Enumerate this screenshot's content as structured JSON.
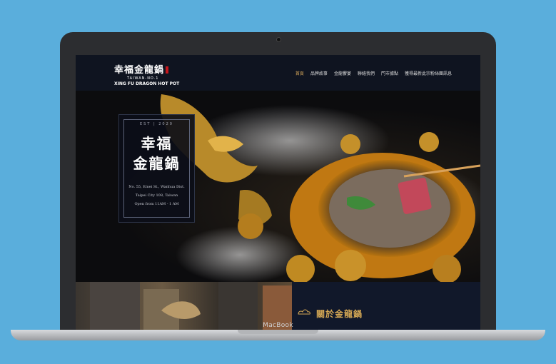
{
  "device": {
    "label": "MacBook"
  },
  "site": {
    "logo": {
      "cn": "幸福金龍鍋",
      "sub": "TAIWAN-NO.1",
      "en": "XING FU DRAGON HOT POT"
    },
    "nav": [
      "首頁",
      "品牌故事",
      "金龍饗宴",
      "聯絡我們",
      "門市據點",
      "獲得最新此宗粉絲團訊息"
    ],
    "hero_card": {
      "est": "EST | 2020",
      "title_line1": "幸福",
      "title_line2": "金龍鍋",
      "address1": "No. 55, Emei St., Wanhua Dist.",
      "address2": "Taipei City 108, Taiwan",
      "hours": "Open from 11AM - 1 AM"
    },
    "about_title": "關於金龍鍋"
  },
  "colors": {
    "background": "#5aaedc",
    "header": "#0f1420",
    "gold": "#d2a45a",
    "logo_red": "#c4161c"
  }
}
